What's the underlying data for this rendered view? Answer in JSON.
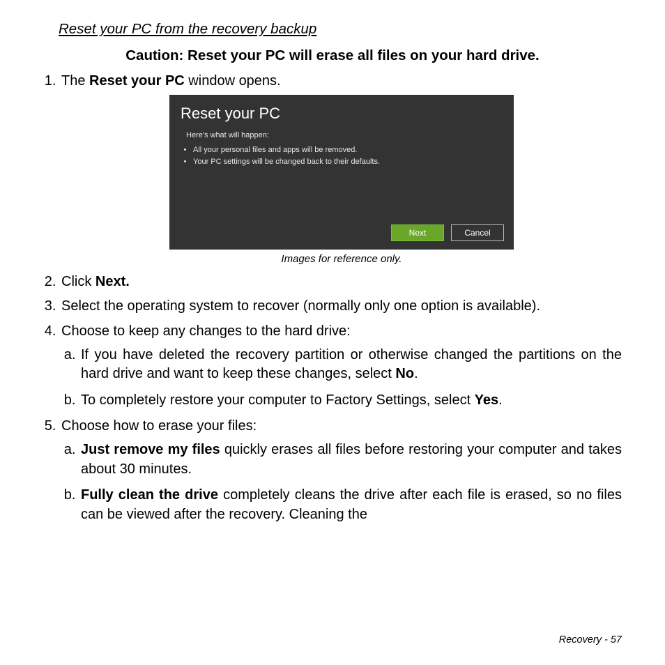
{
  "heading": "Reset your PC from the recovery backup",
  "caution": "Caution: Reset your PC will erase all files on your hard drive.",
  "steps": {
    "s1_pre": "The ",
    "s1_bold": "Reset your PC",
    "s1_post": " window opens.",
    "s2_pre": "Click ",
    "s2_bold": "Next.",
    "s3": "Select the operating system to recover (normally only one option is available).",
    "s4": "Choose to keep any changes to the hard drive:",
    "s4a_pre": "If you have deleted the recovery partition or otherwise changed the partitions on the hard drive and want to keep these changes, select ",
    "s4a_bold": "No",
    "s4a_post": ".",
    "s4b_pre": "To completely restore your computer to Factory Settings, select ",
    "s4b_bold": "Yes",
    "s4b_post": ".",
    "s5": "Choose how to erase your files:",
    "s5a_bold": "Just remove my files",
    "s5a_post": " quickly erases all files before restoring your computer and takes about 30 minutes.",
    "s5b_bold": "Fully clean the drive",
    "s5b_post": " completely cleans the drive after each file is erased, so no files can be viewed after the recovery. Cleaning the"
  },
  "screenshot": {
    "title": "Reset your PC",
    "subtitle": "Here's what will happen:",
    "bullet1": "All your personal files and apps will be removed.",
    "bullet2": "Your PC settings will be changed back to their defaults.",
    "next": "Next",
    "cancel": "Cancel",
    "caption": "Images for reference only."
  },
  "footer": "Recovery -  57"
}
